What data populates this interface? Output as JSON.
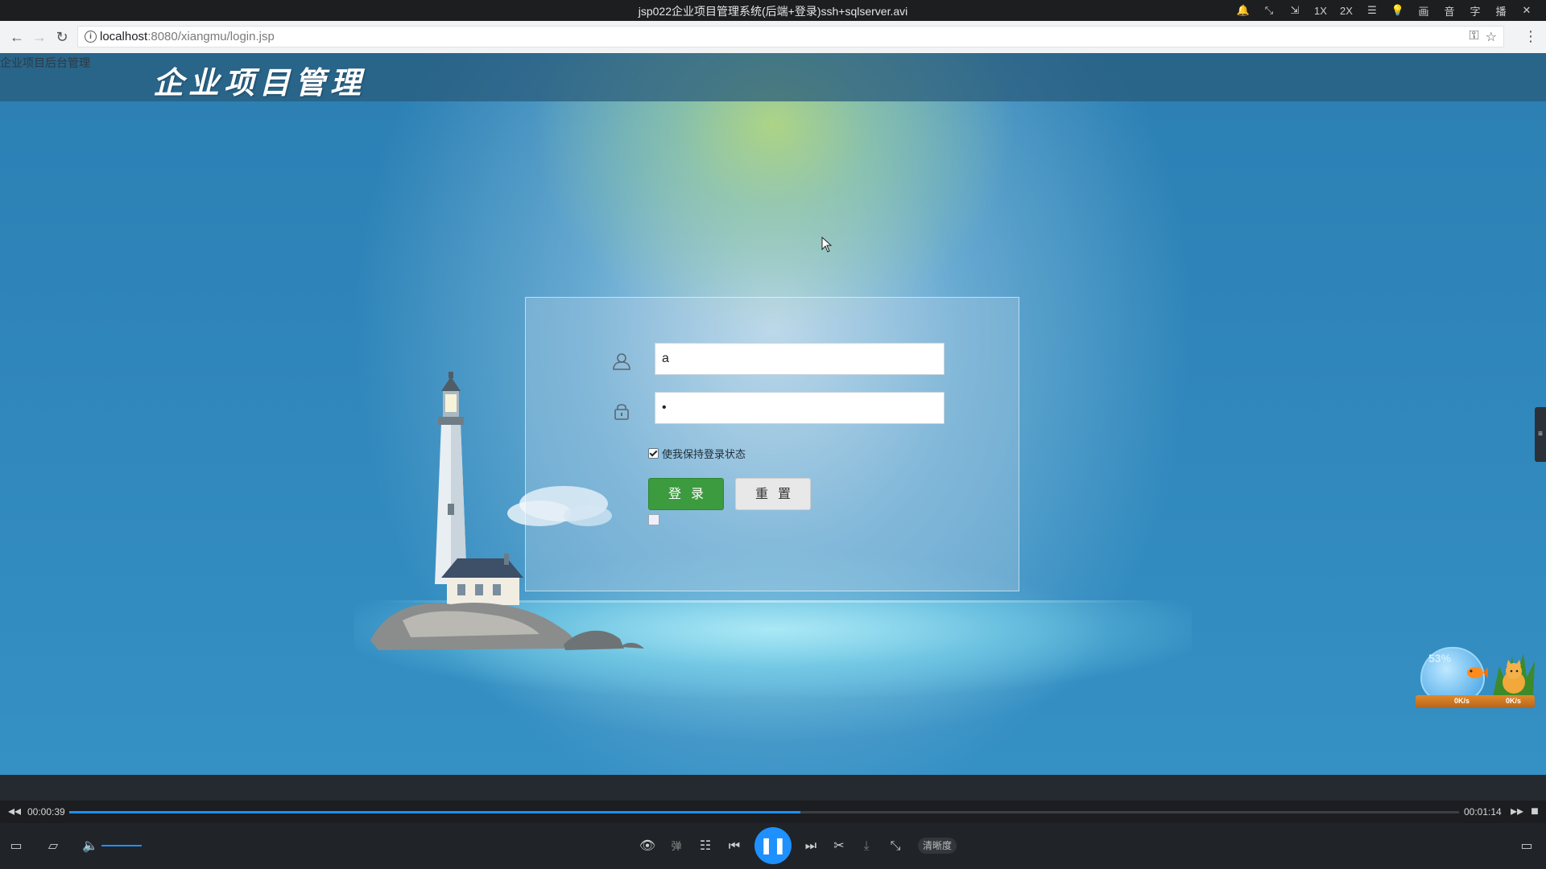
{
  "player": {
    "title": "jsp022企业项目管理系统(后端+登录)ssh+sqlserver.avi",
    "tools": [
      "🔔",
      "⤡",
      "⇲",
      "1X",
      "2X",
      "☰",
      "💡",
      "画",
      "音",
      "字",
      "播",
      "✕"
    ],
    "time_current": "00:00:39",
    "time_total": "00:01:14",
    "progress": 0.526,
    "volume": 0.6,
    "quality_label": "清晰度",
    "danmu_label": "弹"
  },
  "browser": {
    "url_host": "localhost",
    "url_path": ":8080/xiangmu/login.jsp"
  },
  "page": {
    "header_small_text": "企业项目后台管理",
    "logo_text": "企业项目管理"
  },
  "login": {
    "username_value": "a",
    "password_value": "•",
    "remember_label": "使我保持登录状态",
    "remember_checked": true,
    "login_label": "登录",
    "reset_label": "重置"
  },
  "widget": {
    "percent": "53%",
    "up_speed": "0K/s",
    "down_speed": "0K/s"
  },
  "colors": {
    "accent": "#1e90ff",
    "login_button": "#3c9a3f",
    "background": "#2b7fb3"
  }
}
